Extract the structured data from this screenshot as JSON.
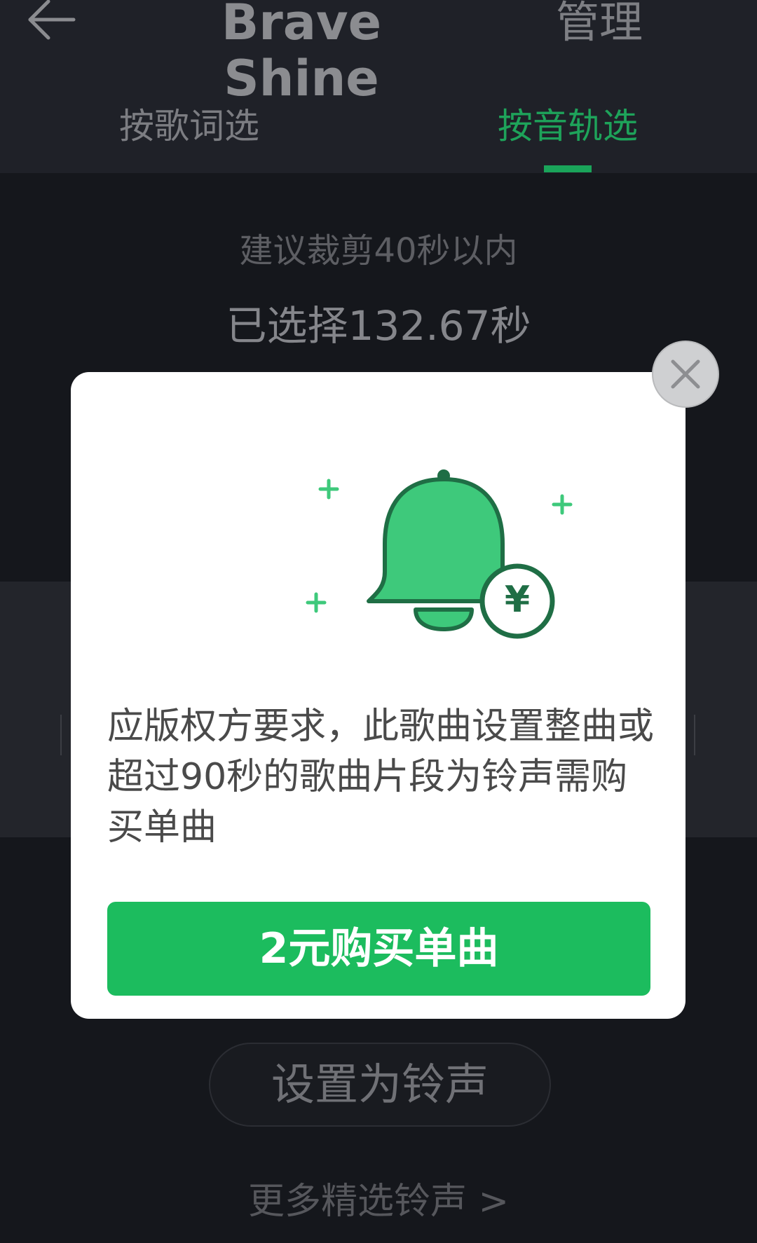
{
  "header": {
    "title": "Brave Shine",
    "manage_label": "管理",
    "tabs": [
      {
        "label": "按歌词选",
        "active": false
      },
      {
        "label": "按音轨选",
        "active": true
      }
    ]
  },
  "main": {
    "hint": "建议裁剪40秒以内",
    "selected": "已选择132.67秒",
    "set_ringtone_label": "设置为铃声",
    "more_link": "更多精选铃声 >"
  },
  "modal": {
    "message": "应版权方要求，此歌曲设置整曲或超过90秒的歌曲片段为铃声需购买单曲",
    "buy_button": "2元购买单曲",
    "currency_symbol": "¥"
  },
  "colors": {
    "accent": "#1cbc5e",
    "bell": "#3ec97b",
    "background": "#15171c"
  }
}
